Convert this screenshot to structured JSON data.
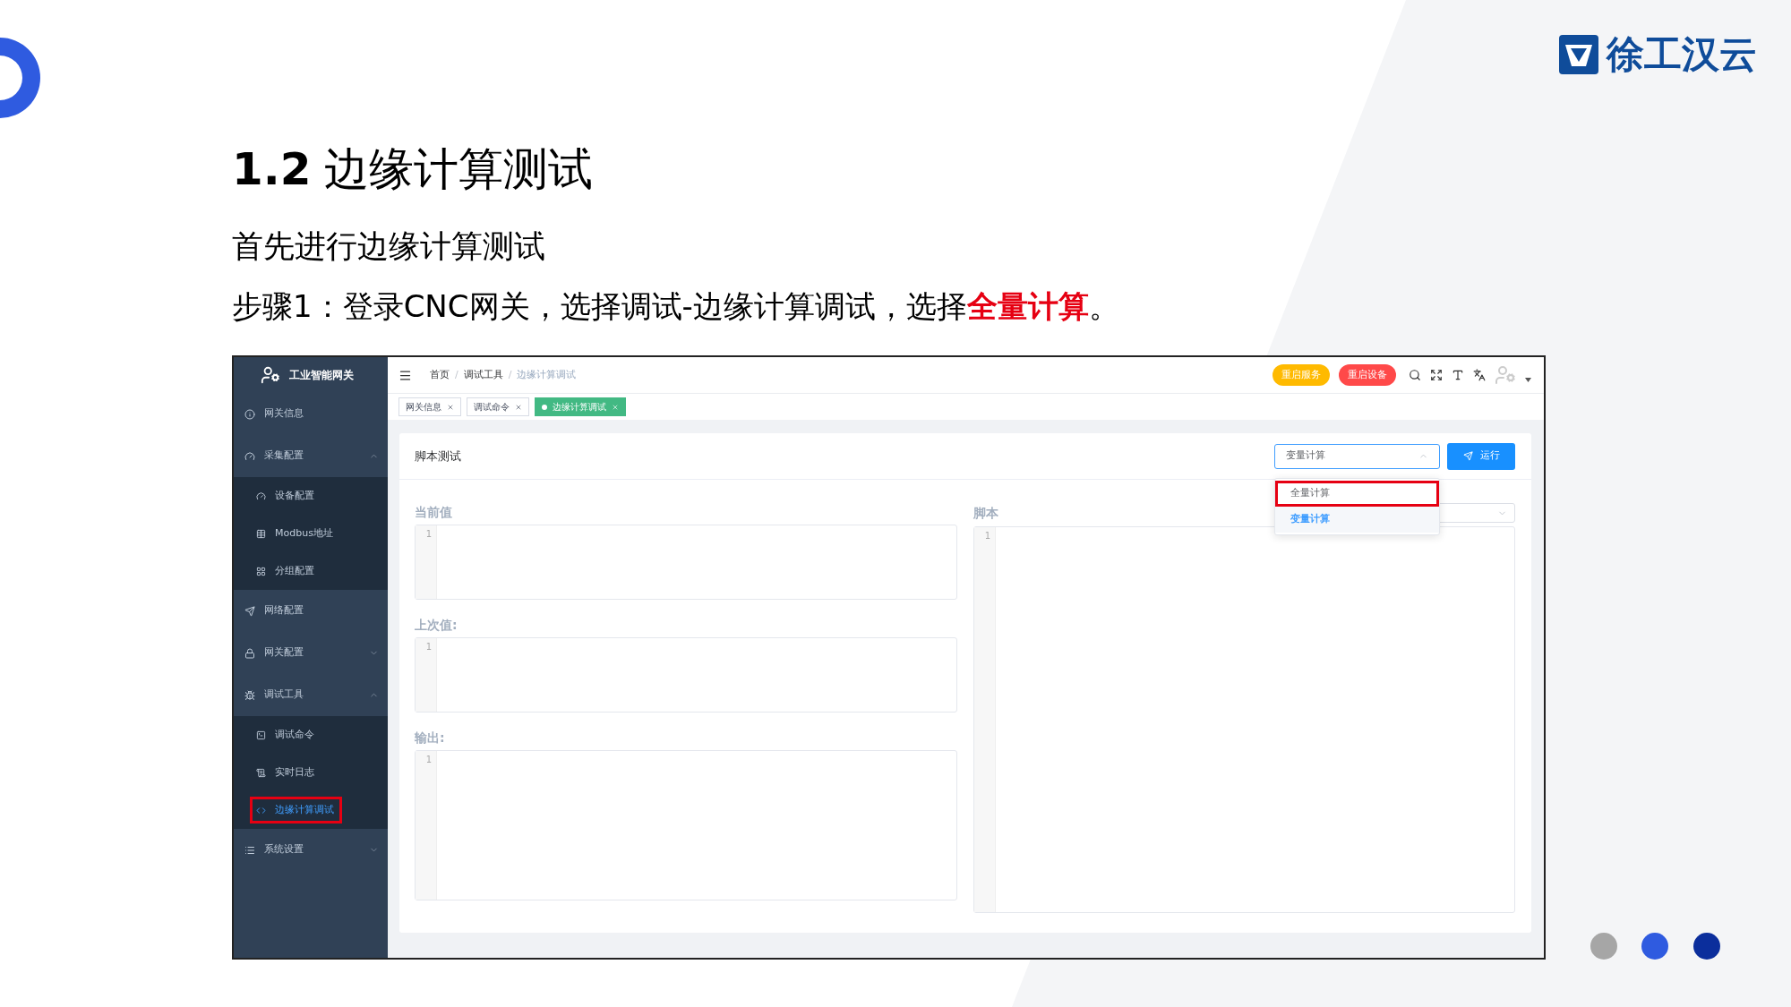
{
  "logo": {
    "text": "徐工汉云"
  },
  "slide": {
    "title_number": "1.2",
    "title": "边缘计算测试",
    "subtitle": "首先进行边缘计算测试",
    "step": "步骤1：登录CNC网关，选择调试-边缘计算调试，选择**全量计算**。"
  },
  "app": {
    "sidebar": {
      "brand": "工业智能网关",
      "items": [
        {
          "label": "网关信息"
        },
        {
          "label": "采集配置",
          "expanded": true,
          "children": [
            {
              "label": "设备配置",
              "selected": false,
              "annotated": false
            },
            {
              "label": "Modbus地址",
              "selected": false,
              "annotated": false
            },
            {
              "label": "分组配置",
              "selected": false,
              "annotated": false
            }
          ]
        },
        {
          "label": "网络配置"
        },
        {
          "label": "网关配置",
          "expanded": false
        },
        {
          "label": "调试工具",
          "expanded": true,
          "children": [
            {
              "label": "调试命令",
              "selected": false,
              "annotated": false
            },
            {
              "label": "实时日志",
              "selected": false,
              "annotated": false
            },
            {
              "label": "边缘计算调试",
              "selected": true,
              "annotated": true
            }
          ]
        },
        {
          "label": "系统设置",
          "expanded": false
        }
      ]
    },
    "breadcrumb": [
      {
        "label": "首页",
        "current": false
      },
      {
        "separator": "/",
        "label": "调试工具",
        "current": false
      },
      {
        "separator": "/",
        "label": "边缘计算调试",
        "current": true
      }
    ],
    "header_buttons": [
      {
        "label": "重启服务",
        "color": "#ffba00"
      },
      {
        "label": "重启设备",
        "color": "#ff4949"
      }
    ],
    "tabs": [
      {
        "label": "网关信息",
        "selected": false
      },
      {
        "label": "调试命令",
        "selected": false
      },
      {
        "label": "边缘计算调试",
        "selected": true
      }
    ],
    "card": {
      "title": "脚本测试",
      "mode_select": {
        "value": "变量计算",
        "expanded": true,
        "options": [
          {
            "label": "全量计算",
            "selected": false,
            "annotated": true
          },
          {
            "label": "变量计算",
            "selected": true,
            "annotated": false
          }
        ]
      },
      "run_button": "运行",
      "left_panels": [
        {
          "label": "当前值",
          "line_number": "1"
        },
        {
          "label": "上次值:",
          "line_number": "1"
        },
        {
          "label": "输出:",
          "line_number": "1"
        }
      ],
      "right_panel": {
        "label": "脚本",
        "line_number": "1"
      }
    }
  }
}
